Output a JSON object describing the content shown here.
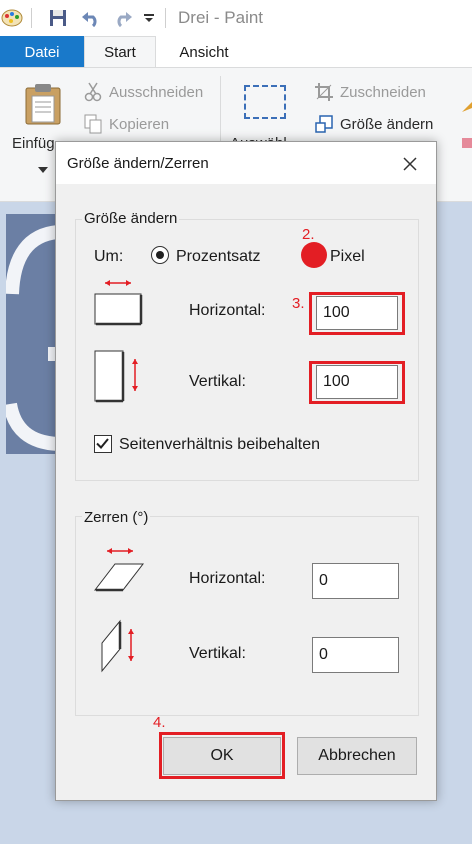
{
  "app": {
    "title": "Drei - Paint"
  },
  "tabs": [
    {
      "label": "Datei"
    },
    {
      "label": "Start"
    },
    {
      "label": "Ansicht"
    }
  ],
  "ribbon": {
    "paste": "Einfüg",
    "cut": "Ausschneiden",
    "copy": "Kopieren",
    "select": "Auswähl",
    "crop": "Zuschneiden",
    "resize": "Größe ändern"
  },
  "dialog": {
    "title": "Größe ändern/Zerren",
    "resize_group": "Größe ändern",
    "by_label": "Um:",
    "percent_option": "Prozentsatz",
    "pixel_option": "Pixel",
    "horizontal_label": "Horizontal:",
    "horizontal_value": "100",
    "vertical_label": "Vertikal:",
    "vertical_value": "100",
    "keep_ratio_label": "Seitenverhältnis beibehalten",
    "skew_group": "Zerren (°)",
    "skew_horizontal_label": "Horizontal:",
    "skew_horizontal_value": "0",
    "skew_vertical_label": "Vertikal:",
    "skew_vertical_value": "0",
    "ok_label": "OK",
    "cancel_label": "Abbrechen"
  },
  "annotations": {
    "step2": "2.",
    "step3": "3.",
    "step4": "4."
  },
  "state": {
    "selected_unit": "Pixel",
    "keep_ratio_checked": true
  },
  "colors": {
    "accent_blue": "#1979ca",
    "annotation_red": "#e31e24",
    "dialog_bg": "#f0f0f0",
    "canvas_bg": "#c9d6e8"
  }
}
